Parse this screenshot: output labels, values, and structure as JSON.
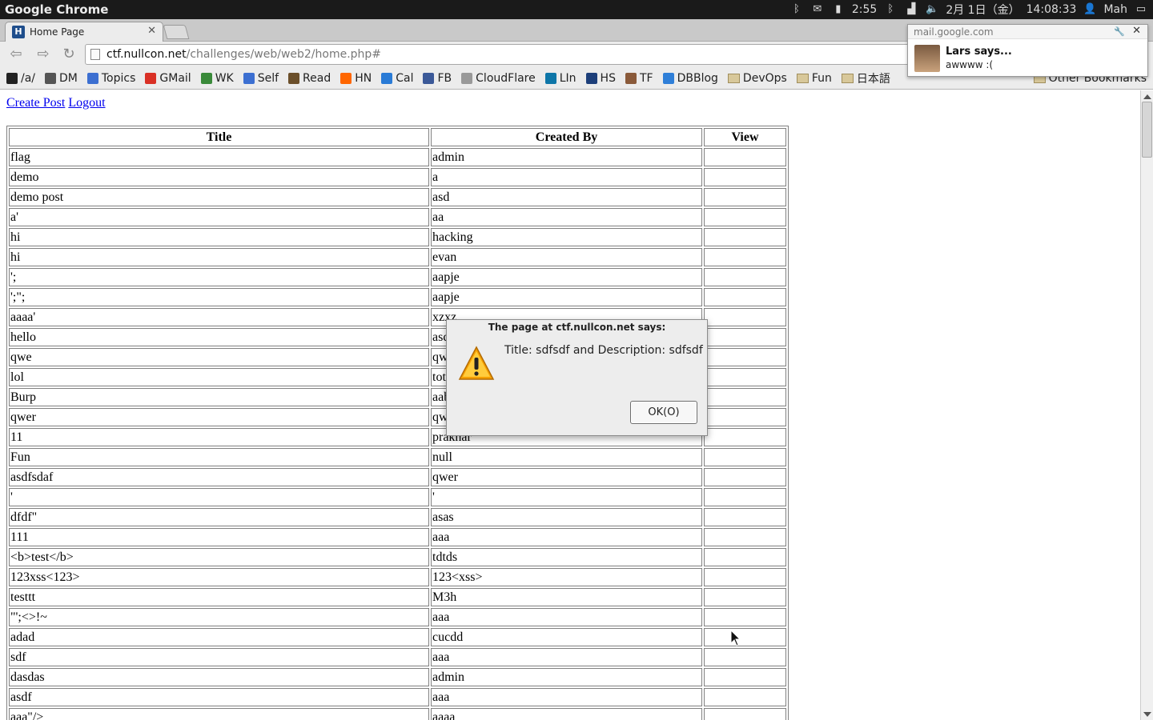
{
  "system_panel": {
    "app_name": "Google Chrome",
    "battery": "2:55",
    "date": "2月 1日（金）",
    "time": "14:08:33",
    "user": "Mah"
  },
  "tab": {
    "title": "Home Page",
    "favicon_letter": "H"
  },
  "toolbar": {
    "url_host": "ctf.nullcon.net",
    "url_path": "/challenges/web/web2/home.php#"
  },
  "bookmarks": {
    "items": [
      {
        "label": "/a/",
        "icon": "apps-icon",
        "color": "#222222"
      },
      {
        "label": "DM",
        "icon": "grid-icon",
        "color": "#555555"
      },
      {
        "label": "Topics",
        "icon": "doc-icon",
        "color": "#3c6fd1"
      },
      {
        "label": "GMail",
        "icon": "gmail-icon",
        "color": "#d93025"
      },
      {
        "label": "WK",
        "icon": "globe-icon",
        "color": "#3a8a3a"
      },
      {
        "label": "Self",
        "icon": "doc-icon",
        "color": "#3c6fd1"
      },
      {
        "label": "Read",
        "icon": "kindle-icon",
        "color": "#6b4f2a"
      },
      {
        "label": "HN",
        "icon": "hn-icon",
        "color": "#ff6600"
      },
      {
        "label": "Cal",
        "icon": "calendar-icon",
        "color": "#2a7bd6"
      },
      {
        "label": "FB",
        "icon": "facebook-icon",
        "color": "#3b5998"
      },
      {
        "label": "CloudFlare",
        "icon": "page-icon",
        "color": "#999999"
      },
      {
        "label": "LIn",
        "icon": "linkedin-icon",
        "color": "#0e76a8"
      },
      {
        "label": "HS",
        "icon": "hs-icon",
        "color": "#1d3f7a"
      },
      {
        "label": "TF",
        "icon": "tf-icon",
        "color": "#8a5a3a"
      },
      {
        "label": "DBBlog",
        "icon": "dropbox-icon",
        "color": "#2f7fd8"
      },
      {
        "label": "DevOps",
        "icon": "folder-icon",
        "color": "#d8c89a"
      },
      {
        "label": "Fun",
        "icon": "folder-icon",
        "color": "#d8c89a"
      },
      {
        "label": "日本語",
        "icon": "folder-icon",
        "color": "#d8c89a"
      }
    ],
    "other": "Other Bookmarks"
  },
  "notification": {
    "source": "mail.google.com",
    "title": "Lars says...",
    "body": "awwww :("
  },
  "page": {
    "create_post": "Create Post",
    "logout": "Logout",
    "headers": [
      "Title",
      "Created By",
      "View"
    ],
    "rows": [
      [
        "flag",
        "admin",
        ""
      ],
      [
        "demo",
        "a",
        ""
      ],
      [
        "demo post",
        "asd",
        ""
      ],
      [
        "a'",
        "aa",
        ""
      ],
      [
        "hi",
        "hacking",
        ""
      ],
      [
        "hi",
        "evan",
        ""
      ],
      [
        "';",
        "aapje",
        ""
      ],
      [
        "';\";",
        "aapje",
        ""
      ],
      [
        "aaaa'",
        "xzxz",
        ""
      ],
      [
        "hello",
        "asd",
        ""
      ],
      [
        "qwe",
        "qwe",
        ""
      ],
      [
        "lol",
        "tot",
        ""
      ],
      [
        "Burp",
        "aab",
        ""
      ],
      [
        "qwer",
        "qwe",
        ""
      ],
      [
        "11",
        "praknar",
        ""
      ],
      [
        "Fun",
        "null",
        ""
      ],
      [
        "asdfsdaf",
        "qwer",
        ""
      ],
      [
        "'",
        "'",
        ""
      ],
      [
        "dfdf\"",
        "asas",
        ""
      ],
      [
        "111",
        "aaa",
        ""
      ],
      [
        "<b>test</b>",
        "tdtds",
        ""
      ],
      [
        "123xss<123>",
        "123<xss>",
        ""
      ],
      [
        "testtt",
        "M3h",
        ""
      ],
      [
        "\"';<>!~",
        "aaa",
        ""
      ],
      [
        "adad",
        "cucdd",
        ""
      ],
      [
        "sdf",
        "aaa",
        ""
      ],
      [
        "dasdas",
        "admin",
        ""
      ],
      [
        "asdf",
        "aaa",
        ""
      ],
      [
        "aaa\"/>",
        "aaaa",
        ""
      ]
    ]
  },
  "dialog": {
    "title": "The page at ctf.nullcon.net says:",
    "message": "Title: sdfsdf and Description: sdfsdf",
    "ok_label": "OK(O)"
  }
}
